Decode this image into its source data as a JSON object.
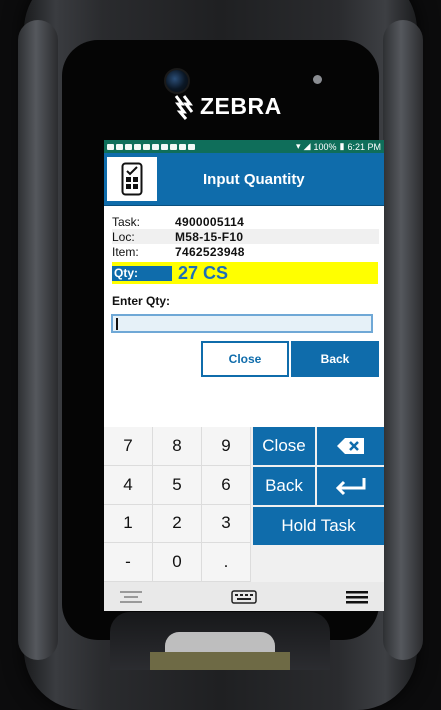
{
  "device": {
    "brand": "ZEBRA"
  },
  "statusbar": {
    "battery": "100%",
    "time": "6:21 PM"
  },
  "header": {
    "title": "Input Quantity",
    "icon": "mobile-checklist-icon"
  },
  "details": [
    {
      "label": "Task:",
      "value": "4900005114"
    },
    {
      "label": "Loc:",
      "value": "M58-15-F10"
    },
    {
      "label": "Item:",
      "value": "7462523948"
    }
  ],
  "qty": {
    "label": "Qty:",
    "value": "27 CS"
  },
  "entry": {
    "label": "Enter Qty:",
    "value": ""
  },
  "buttons": {
    "close": "Close",
    "back": "Back"
  },
  "keypad": {
    "keys": [
      "7",
      "8",
      "9",
      "4",
      "5",
      "6",
      "1",
      "2",
      "3",
      "-",
      "0",
      "."
    ],
    "actions": {
      "close": "Close",
      "backspace_icon": "backspace-icon",
      "back": "Back",
      "enter_icon": "enter-icon",
      "hold": "Hold Task"
    }
  },
  "colors": {
    "accent": "#0f6cab",
    "highlight": "#ffff00",
    "statusbar": "#0f6e5a"
  }
}
